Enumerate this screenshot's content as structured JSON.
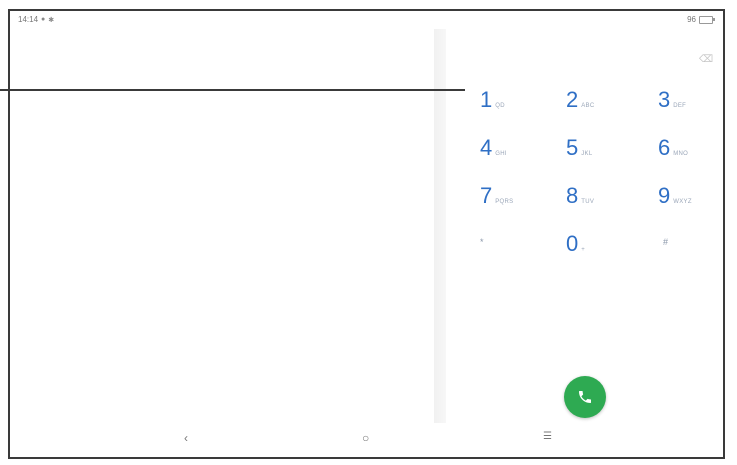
{
  "status_bar": {
    "time": "14:14",
    "left_icons": [
      "notification-icon",
      "settings-icon"
    ],
    "right_text": "96"
  },
  "dialpad": {
    "keys": [
      {
        "digit": "1",
        "letters": "QD"
      },
      {
        "digit": "2",
        "letters": "ABC"
      },
      {
        "digit": "3",
        "letters": "DEF"
      },
      {
        "digit": "4",
        "letters": "GHI"
      },
      {
        "digit": "5",
        "letters": "JKL"
      },
      {
        "digit": "6",
        "letters": "MNO"
      },
      {
        "digit": "7",
        "letters": "PQRS"
      },
      {
        "digit": "8",
        "letters": "TUV"
      },
      {
        "digit": "9",
        "letters": "WXYZ"
      },
      {
        "digit": "*",
        "letters": ""
      },
      {
        "digit": "0",
        "letters": "+"
      },
      {
        "digit": "#",
        "letters": ""
      }
    ],
    "backspace_icon": "backspace-icon",
    "call_icon": "phone-icon",
    "call_color": "#2eaa52",
    "digit_color": "#2f6fc5"
  },
  "nav": {
    "back": "‹",
    "home": "○",
    "recents": "☰"
  }
}
